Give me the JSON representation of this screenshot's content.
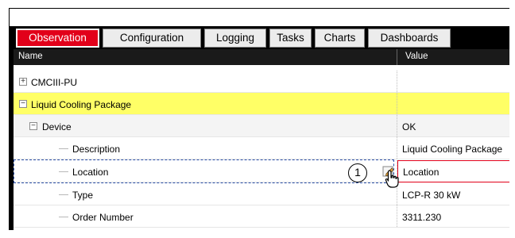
{
  "tabs": [
    "Observation",
    "Configuration",
    "Logging",
    "Tasks",
    "Charts",
    "Dashboards"
  ],
  "active_tab": "Observation",
  "columns": {
    "name": "Name",
    "value": "Value"
  },
  "rows": [
    {
      "name": "CMCIII-PU",
      "value": "",
      "expander": "+"
    },
    {
      "name": "Liquid Cooling Package",
      "value": "",
      "expander": "−"
    },
    {
      "name": "Device",
      "value": "OK",
      "expander": "−"
    },
    {
      "name": "Description",
      "value": "Liquid Cooling Package"
    },
    {
      "name": "Location",
      "value": "Location"
    },
    {
      "name": "Type",
      "value": "LCP-R 30 kW"
    },
    {
      "name": "Order Number",
      "value": "3311.230"
    }
  ],
  "callout_number": "1",
  "colors": {
    "accent": "#e2001a",
    "highlight": "#ffff66",
    "selection": "#2b50a8"
  },
  "icons": {
    "edit": "edit-pencil-icon",
    "cursor": "hand-pointer-icon"
  }
}
